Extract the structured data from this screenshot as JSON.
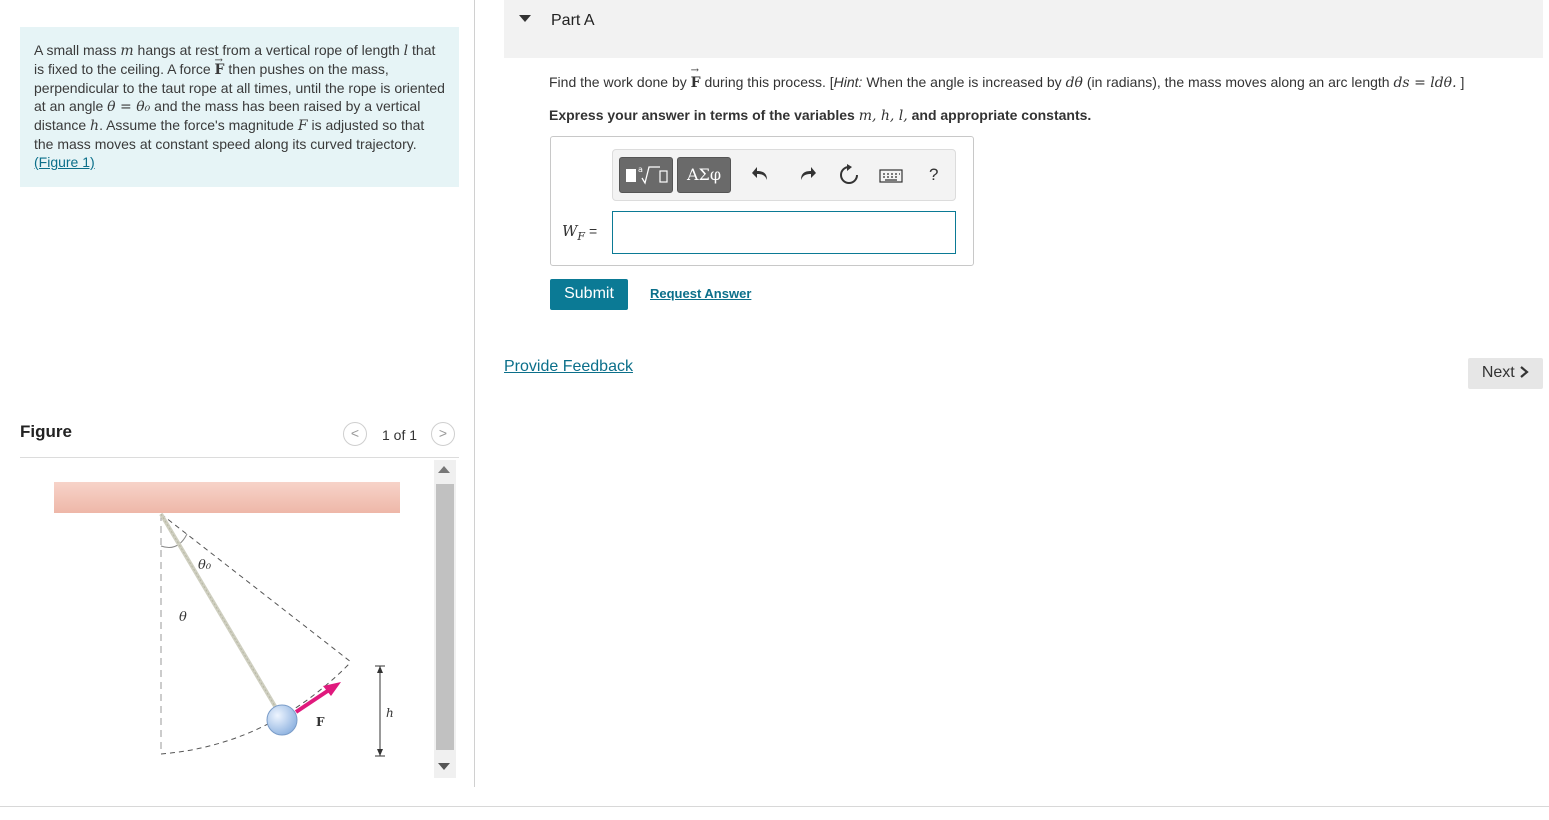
{
  "problem": {
    "s1": "A small mass ",
    "m": "m",
    "s2": " hangs at rest from a vertical rope of length ",
    "l": "l",
    "s3": " that is fixed to the ceiling. A force ",
    "F": "F",
    "s4": " then pushes on the mass, perpendicular to the taut rope at all times, until the rope is oriented at an angle ",
    "theta_eq": "θ = θ₀",
    "s5": " and the mass has been raised by a vertical distance ",
    "h": "h",
    "s6": ". Assume the force's magnitude ",
    "Fmag": "F",
    "s7": " is adjusted so that the mass moves at constant speed along its curved trajectory.",
    "figure_link": "(Figure 1)"
  },
  "partA": {
    "title": "Part A",
    "question_pre": "Find the work done by ",
    "question_F": "F",
    "question_mid": " during this process. [",
    "hint_label": "Hint:",
    "hint_text": " When the angle is increased by ",
    "dtheta": "dθ",
    "hint_text2": " (in radians), the mass moves along an arc length ",
    "arc_eq": "ds = ldθ.",
    "question_end": " ]",
    "instruction_pre": "Express your answer in terms of the variables ",
    "instruction_vars": "m, h, l,",
    "instruction_post": " and appropriate constants."
  },
  "toolbar": {
    "greek_label": "ΑΣφ",
    "help_label": "?",
    "icons": [
      "templates-icon",
      "greek-icon",
      "undo-icon",
      "redo-icon",
      "reset-icon",
      "keyboard-icon",
      "help-icon"
    ]
  },
  "answer": {
    "label": "W",
    "label_sub": "F",
    "label_eq": " =",
    "value": ""
  },
  "buttons": {
    "submit": "Submit",
    "request_answer": "Request Answer",
    "provide_feedback": "Provide Feedback",
    "next": "Next"
  },
  "figure": {
    "label": "Figure",
    "counter": "1 of 1",
    "labels": {
      "theta0": "θ₀",
      "theta": "θ",
      "F": "F",
      "h": "h"
    }
  },
  "colors": {
    "accent": "#0b7a95",
    "problem_bg": "#e6f4f6",
    "ceiling": "#f2c4b8",
    "force_arrow": "#e0197d",
    "mass": "#a9c8ec"
  }
}
